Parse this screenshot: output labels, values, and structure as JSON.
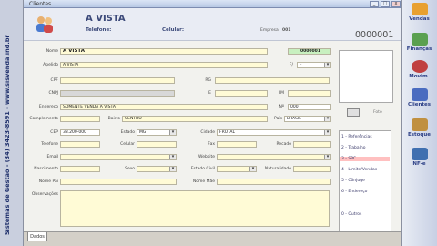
{
  "window": {
    "title": "Clientes"
  },
  "left_banner": {
    "text": "Sistemas de Gestão - (34) 3423-8591 - www.sisvenda.ind.br"
  },
  "header": {
    "nome": "A VISTA",
    "telefone_label": "Telefone:",
    "celular_label": "Celular:",
    "empresa_label": "Empresa:",
    "empresa_value": "001",
    "codigo": "0000001"
  },
  "form": {
    "nome": {
      "label": "Nome",
      "value": "A VISTA",
      "code": "0000001"
    },
    "apelido": {
      "label": "Apelido",
      "value": "A VISTA"
    },
    "pf": {
      "label": "F/",
      "value": "F"
    },
    "cpf": {
      "label": "CPF",
      "value": ""
    },
    "rg": {
      "label": "RG",
      "value": ""
    },
    "cnpj": {
      "label": "CNPJ",
      "value": ""
    },
    "ie": {
      "label": "IE",
      "value": ""
    },
    "im": {
      "label": "IM",
      "value": ""
    },
    "endereco": {
      "label": "Endereço",
      "value": "SOMENTE VENDA A VISTA"
    },
    "numero": {
      "label": "Nº",
      "value": "000"
    },
    "complemento": {
      "label": "Complemento",
      "value": ""
    },
    "bairro": {
      "label": "Bairro",
      "value": "CENTRO"
    },
    "pais": {
      "label": "País",
      "value": "BRASIL"
    },
    "cep": {
      "label": "CEP",
      "value": "38.200-000"
    },
    "estado": {
      "label": "Estado",
      "value": "MG"
    },
    "cidade": {
      "label": "Cidade",
      "value": "FRUTAL"
    },
    "telefone": {
      "label": "Telefone",
      "value": ""
    },
    "celular": {
      "label": "Celular",
      "value": ""
    },
    "fax": {
      "label": "Fax",
      "value": ""
    },
    "recado": {
      "label": "Recado",
      "value": ""
    },
    "email": {
      "label": "Email",
      "value": ""
    },
    "website": {
      "label": "Website",
      "value": ""
    },
    "nascimento": {
      "label": "Nascimento",
      "value": ""
    },
    "sexo": {
      "label": "Sexo",
      "value": ""
    },
    "estado_civil": {
      "label": "Estado Civil",
      "value": ""
    },
    "naturalidade": {
      "label": "Naturalidade",
      "value": ""
    },
    "nome_pai": {
      "label": "Nome Pai",
      "value": ""
    },
    "nome_mae": {
      "label": "Nome Mãe",
      "value": ""
    },
    "observacoes": {
      "label": "Observações",
      "value": ""
    },
    "foto_label": "Foto"
  },
  "side_nav": [
    {
      "label": "1 - Referências"
    },
    {
      "label": "2 - Trabalho"
    },
    {
      "label": "3 - SPC",
      "active": true
    },
    {
      "label": "4 - Limite/Vendas"
    },
    {
      "label": "5 - Cônjuge"
    },
    {
      "label": "6 - Endereço"
    },
    {
      "label": "0 - Outros"
    }
  ],
  "tabs": [
    {
      "label": "Dados"
    }
  ],
  "right_bar": [
    {
      "label": "Vendas",
      "icon": "cart-icon",
      "color": "#e8a030"
    },
    {
      "label": "Finanças",
      "icon": "money-icon",
      "color": "#5aa050"
    },
    {
      "label": "Movim.",
      "icon": "magnifier-icon",
      "color": "#c04040"
    },
    {
      "label": "Clientes",
      "icon": "users-icon",
      "color": "#4a6cc0"
    },
    {
      "label": "Estoque",
      "icon": "box-icon",
      "color": "#c09040"
    },
    {
      "label": "NF-e",
      "icon": "nfe-icon",
      "color": "#4070b0"
    }
  ]
}
